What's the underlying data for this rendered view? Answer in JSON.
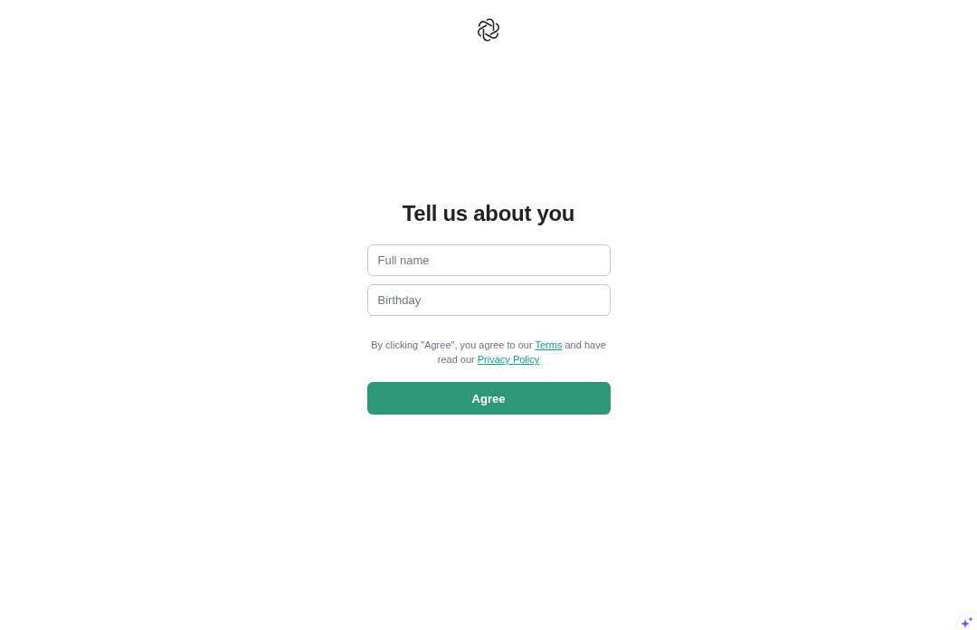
{
  "title": "Tell us about you",
  "fields": [
    {
      "placeholder": "Full name"
    },
    {
      "placeholder": "Birthday"
    }
  ],
  "notice": [
    {
      "kind": "text",
      "text": "By clicking \"Agree\", you agree to our "
    },
    {
      "kind": "link",
      "text": "Terms"
    },
    {
      "kind": "text",
      "text": " and have read our "
    },
    {
      "kind": "link",
      "text": "Privacy Policy"
    }
  ],
  "button": {
    "label": "Agree"
  }
}
